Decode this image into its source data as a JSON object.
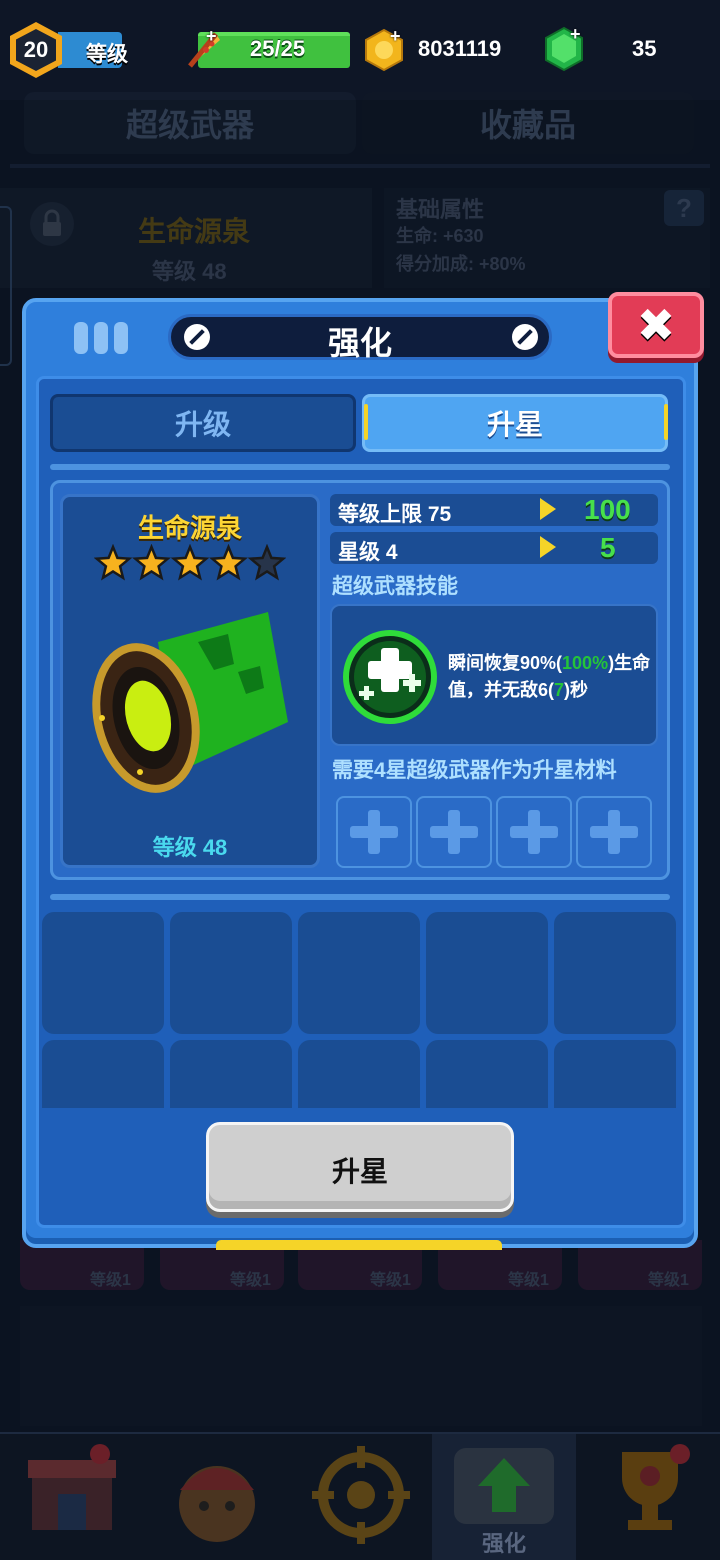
{
  "hud": {
    "player_level": "20",
    "level_label": "等级",
    "energy": "25/25",
    "coins": "8031119",
    "gems": "35",
    "plus": "+"
  },
  "background": {
    "tab_super_weapon": "超级武器",
    "tab_collectibles": "收藏品",
    "weapon_name": "生命源泉",
    "weapon_level": "等级 48",
    "attr_title": "基础属性",
    "attr_life": "生命: +630",
    "attr_score": "得分加成: +80%",
    "help": "?",
    "slot_levels": [
      "等级1",
      "等级1",
      "等级1",
      "等级1",
      "等级1"
    ],
    "nav_active_label": "强化"
  },
  "modal": {
    "title": "强化",
    "close": "✖",
    "tabs": {
      "upgrade": "升级",
      "star_up": "升星"
    },
    "weapon": {
      "name": "生命源泉",
      "stars_filled": 4,
      "stars_total": 5,
      "level": "等级 48"
    },
    "stats": [
      {
        "label": "等级上限 75",
        "new_value": "100"
      },
      {
        "label": "星级 4",
        "new_value": "5"
      }
    ],
    "skill_heading": "超级武器技能",
    "skill": {
      "part1": "瞬间恢复90%(",
      "hl1": "100%",
      "part2": ")生命值，并无敌6(",
      "hl2": "7",
      "part3": ")秒"
    },
    "requirement": "需要4星超级武器作为升星材料",
    "material_slots": 4,
    "button": "升星"
  },
  "colors": {
    "accent_yellow": "#f5d428",
    "stat_green": "#47e04b",
    "modal_blue": "#2f7fdc",
    "close_red": "#e23c56"
  }
}
